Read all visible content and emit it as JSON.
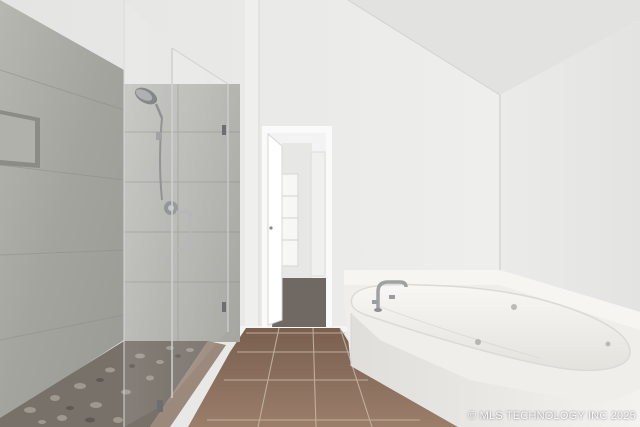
{
  "photo": {
    "subject": "Bathroom with walk-in glass shower, corner jetted tub, tiled floor and doorway to walk-in closet",
    "watermark": "© MLS TECHNOLOGY INC 2025"
  },
  "colors": {
    "wall": "#ececea",
    "ceiling": "#e3e3e1",
    "shower_tile": "#a9a9a4",
    "floor_tile": "#8e7260",
    "tub": "#f2f1ee",
    "pebble": "#6f6a62"
  },
  "icons": [
    "shower-head-icon",
    "faucet-icon"
  ]
}
